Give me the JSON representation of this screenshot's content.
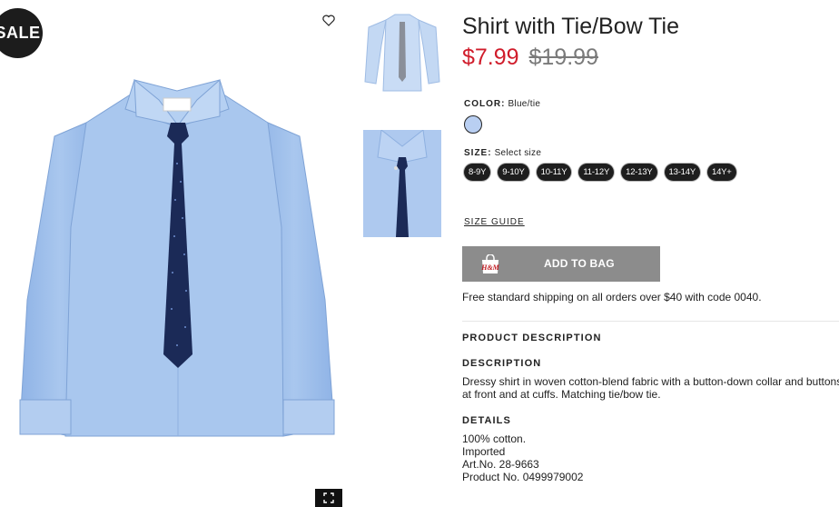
{
  "badge": {
    "sale": "SALE"
  },
  "product": {
    "title": "Shirt with Tie/Bow Tie",
    "price_now": "$7.99",
    "price_old": "$19.99"
  },
  "color": {
    "label": "COLOR:",
    "value": "Blue/tie",
    "swatch_hex": "#b9cff2"
  },
  "size": {
    "label": "SIZE:",
    "value": "Select size",
    "options": [
      "8-9Y",
      "9-10Y",
      "10-11Y",
      "11-12Y",
      "12-13Y",
      "13-14Y",
      "14Y+"
    ]
  },
  "size_guide": "SIZE GUIDE",
  "add_to_bag": {
    "label": "ADD TO BAG",
    "bag_logo": "H&M"
  },
  "shipping": "Free standard shipping on all orders over $40 with code 0040.",
  "sections": {
    "product_description": "PRODUCT DESCRIPTION",
    "description_title": "DESCRIPTION",
    "description_line1": "Dressy shirt in woven cotton-blend fabric with a button-down collar and buttons",
    "description_line2": "at front and at cuffs. Matching tie/bow tie.",
    "details_title": "DETAILS",
    "details": [
      "100% cotton.",
      "Imported",
      "Art.No. 28-9663",
      "Product No. 0499979002"
    ]
  },
  "icons": {
    "favorite": "heart-icon",
    "expand": "expand-icon",
    "bag": "shopping-bag-icon"
  },
  "colors": {
    "sale_badge": "#1c1c1c",
    "price_now": "#d01c2b",
    "add_to_bag_bg": "#8c8c8c",
    "shirt": "#a9c7ee",
    "tie": "#1b2a57"
  }
}
